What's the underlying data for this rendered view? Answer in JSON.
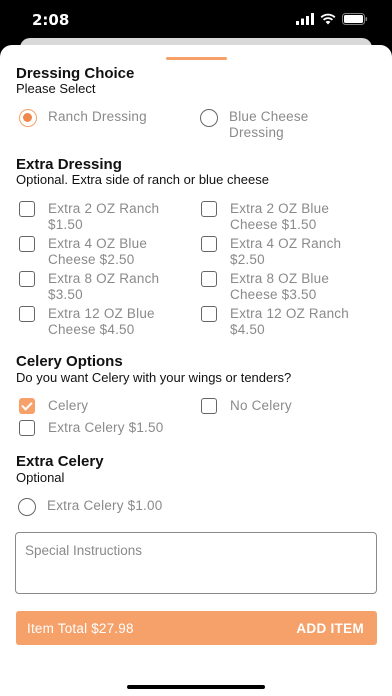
{
  "status_bar": {
    "time": "2:08"
  },
  "dressing_choice": {
    "title": "Dressing Choice",
    "subtitle": "Please Select",
    "options": [
      "Ranch Dressing",
      "Blue Cheese Dressing"
    ],
    "selected": "Ranch Dressing"
  },
  "extra_dressing": {
    "title": "Extra Dressing",
    "subtitle": "Optional. Extra side of ranch or blue cheese",
    "options": [
      "Extra 2 OZ Ranch $1.50",
      "Extra 2 OZ Blue Cheese $1.50",
      "Extra 4 OZ Blue Cheese $2.50",
      "Extra 4 OZ Ranch $2.50",
      "Extra 8 OZ Ranch $3.50",
      "Extra 8 OZ Blue Cheese $3.50",
      "Extra 12 OZ Blue Cheese $4.50",
      "Extra 12 OZ Ranch $4.50"
    ]
  },
  "celery_options": {
    "title": "Celery Options",
    "subtitle": "Do you want Celery with your wings or tenders?",
    "options": [
      "Celery",
      "No Celery",
      "Extra Celery $1.50"
    ],
    "checked": [
      "Celery"
    ]
  },
  "extra_celery": {
    "title": "Extra Celery",
    "subtitle": "Optional",
    "options": [
      "Extra Celery $1.00"
    ]
  },
  "special_instructions": {
    "placeholder": "Special Instructions",
    "value": ""
  },
  "footer": {
    "total": "Item Total $27.98",
    "add_label": "ADD ITEM"
  },
  "colors": {
    "accent": "#f6a06a",
    "accent_dark": "#f0884c",
    "muted_text": "#8a8a8a"
  }
}
